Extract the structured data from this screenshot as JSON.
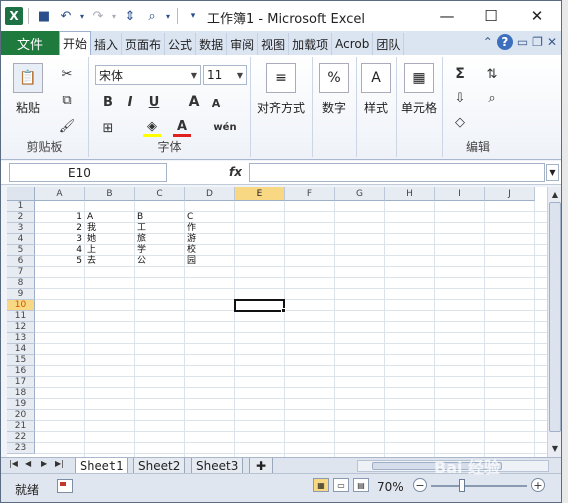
{
  "window": {
    "title": "工作簿1 - Microsoft Excel"
  },
  "qat": {
    "app_icon": "X"
  },
  "tabs": [
    {
      "label": "文件"
    },
    {
      "label": "开始"
    },
    {
      "label": "插入"
    },
    {
      "label": "页面布"
    },
    {
      "label": "公式"
    },
    {
      "label": "数据"
    },
    {
      "label": "审阅"
    },
    {
      "label": "视图"
    },
    {
      "label": "加载项"
    },
    {
      "label": "Acrob"
    },
    {
      "label": "团队"
    }
  ],
  "ribbon": {
    "clipboard": {
      "paste": "粘贴",
      "label": "剪贴板"
    },
    "font": {
      "name": "宋体",
      "size": "11",
      "bold": "B",
      "italic": "I",
      "underline": "U",
      "label": "字体",
      "grow": "A",
      "shrink": "A",
      "color_a": "A",
      "wen": "wén"
    },
    "alignment": {
      "label": "对齐方式"
    },
    "number": {
      "label": "数字",
      "icon": "%"
    },
    "styles": {
      "label": "样式"
    },
    "cells": {
      "label": "单元格"
    },
    "editing": {
      "label": "编辑",
      "sum": "Σ"
    }
  },
  "formula_bar": {
    "name_box": "E10",
    "fx": "fx",
    "formula": ""
  },
  "grid": {
    "columns": [
      "A",
      "B",
      "C",
      "D",
      "E",
      "F",
      "G",
      "H",
      "I",
      "J"
    ],
    "rows": [
      "1",
      "2",
      "3",
      "4",
      "5",
      "6",
      "7",
      "8",
      "9",
      "10",
      "11",
      "12",
      "13",
      "14",
      "15",
      "16",
      "17",
      "18",
      "19",
      "20",
      "21",
      "22",
      "23"
    ],
    "selected_column": "E",
    "selected_row": "10",
    "cells": [
      {
        "row": 2,
        "col": "A",
        "value": "1"
      },
      {
        "row": 3,
        "col": "A",
        "value": "2"
      },
      {
        "row": 4,
        "col": "A",
        "value": "3"
      },
      {
        "row": 5,
        "col": "A",
        "value": "4"
      },
      {
        "row": 6,
        "col": "A",
        "value": "5"
      },
      {
        "row": 2,
        "col": "B",
        "value": "A"
      },
      {
        "row": 3,
        "col": "B",
        "value": "我"
      },
      {
        "row": 4,
        "col": "B",
        "value": "她"
      },
      {
        "row": 5,
        "col": "B",
        "value": "上"
      },
      {
        "row": 6,
        "col": "B",
        "value": "去"
      },
      {
        "row": 2,
        "col": "C",
        "value": "B"
      },
      {
        "row": 3,
        "col": "C",
        "value": "工"
      },
      {
        "row": 4,
        "col": "C",
        "value": "旅"
      },
      {
        "row": 5,
        "col": "C",
        "value": "学"
      },
      {
        "row": 6,
        "col": "C",
        "value": "公"
      },
      {
        "row": 2,
        "col": "D",
        "value": "C"
      },
      {
        "row": 3,
        "col": "D",
        "value": "作"
      },
      {
        "row": 4,
        "col": "D",
        "value": "游"
      },
      {
        "row": 5,
        "col": "D",
        "value": "校"
      },
      {
        "row": 6,
        "col": "D",
        "value": "园"
      }
    ]
  },
  "sheets": [
    {
      "label": "Sheet1"
    },
    {
      "label": "Sheet2"
    },
    {
      "label": "Sheet3"
    }
  ],
  "status": {
    "text": "就绪",
    "zoom": "70%"
  },
  "watermark": "Bai 经验"
}
